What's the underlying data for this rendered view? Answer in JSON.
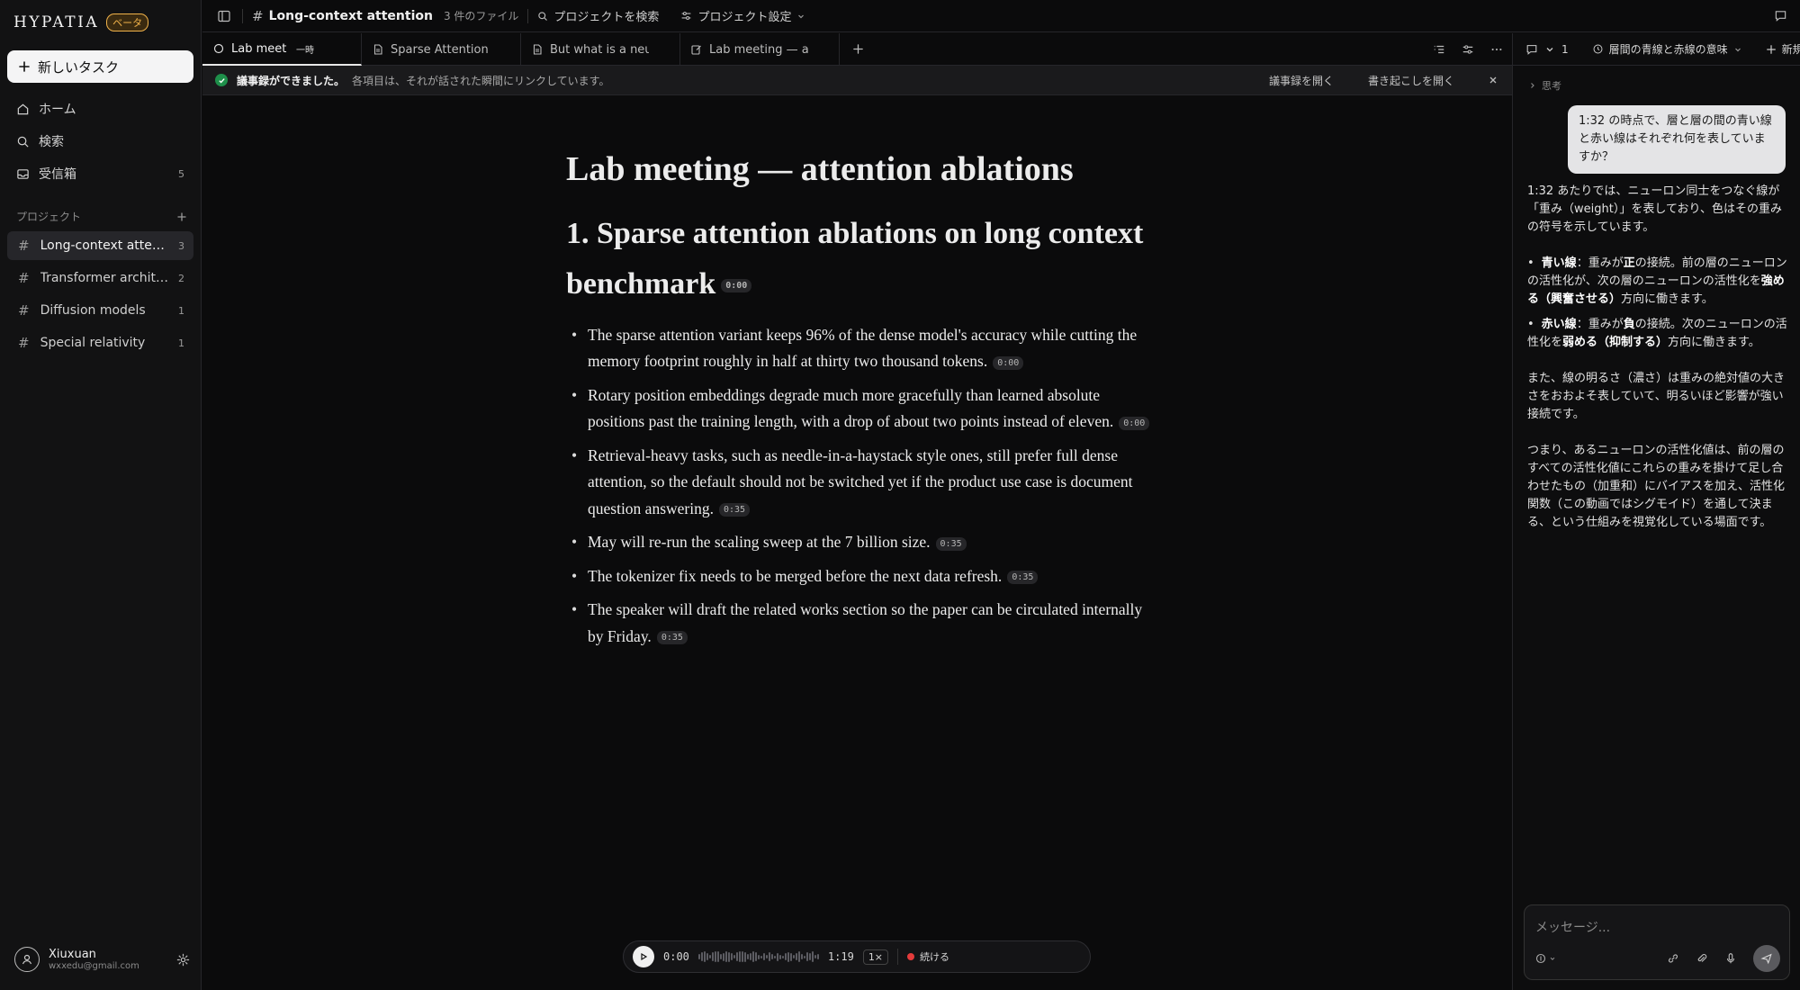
{
  "app": {
    "logo_text": "HYPATIA",
    "beta_label": "ベータ"
  },
  "sidebar": {
    "new_task_label": "新しいタスク",
    "nav": [
      {
        "label": "ホーム",
        "icon": "home-icon"
      },
      {
        "label": "検索",
        "icon": "search-icon"
      },
      {
        "label": "受信箱",
        "icon": "inbox-icon",
        "count": "5"
      }
    ],
    "projects_label": "プロジェクト",
    "projects": [
      {
        "name": "Long-context attention",
        "count": "3",
        "active": true
      },
      {
        "name": "Transformer architectures",
        "count": "2"
      },
      {
        "name": "Diffusion models",
        "count": "1"
      },
      {
        "name": "Special relativity",
        "count": "1"
      }
    ],
    "user": {
      "name": "Xiuxuan",
      "email": "wxxedu@gmail.com"
    }
  },
  "topbar": {
    "project_title": "Long-context attention",
    "file_count": "3 件のファイル",
    "search_label": "プロジェクトを検索",
    "settings_label": "プロジェクト設定"
  },
  "tabs": [
    {
      "title": "Lab meeting — attention ablations",
      "badge": "一時",
      "active": true
    },
    {
      "title": "Sparse Attention Benchmarks"
    },
    {
      "title": "But what is a neural network"
    },
    {
      "title": "Lab meeting — attention ablations"
    }
  ],
  "banner": {
    "title": "議事録ができました。",
    "subtitle": "各項目は、それが話された瞬間にリンクしています。",
    "open_minutes": "議事録を開く",
    "open_transcript": "書き起こしを開く"
  },
  "document": {
    "title": "Lab meeting — attention ablations",
    "section_title": "1. Sparse attention ablations on long context benchmark",
    "section_ts": "0:00",
    "bullets": [
      {
        "text": "The sparse attention variant keeps 96% of the dense model's accuracy while cutting the memory footprint roughly in half at thirty two thousand tokens.",
        "ts": "0:00"
      },
      {
        "text": "Rotary position embeddings degrade much more gracefully than learned absolute positions past the training length, with a drop of about two points instead of eleven.",
        "ts": "0:00"
      },
      {
        "text": "Retrieval-heavy tasks, such as needle-in-a-haystack style ones, still prefer full dense attention, so the default should not be switched yet if the product use case is document question answering.",
        "ts": "0:35"
      },
      {
        "text": "May will re-run the scaling sweep at the 7 billion size.",
        "ts": "0:35"
      },
      {
        "text": "The tokenizer fix needs to be merged before the next data refresh.",
        "ts": "0:35"
      },
      {
        "text": "The speaker will draft the related works section so the paper can be circulated internally by Friday.",
        "ts": "0:35"
      }
    ]
  },
  "player": {
    "current": "0:00",
    "duration": "1:19",
    "speed": "1×",
    "continue_label": "続ける"
  },
  "chat": {
    "conversation_count": "1",
    "conversation_title": "層間の青線と赤線の意味",
    "new_label": "新規",
    "thinking_label": "思考",
    "user_message": "1:32 の時点で、層と層の間の青い線と赤い線はそれぞれ何を表していますか？",
    "answer": {
      "intro": "1:32 あたりでは、ニューロン同士をつなぐ線が「重み（weight）」を表しており、色はその重みの符号を示しています。",
      "blue_term": "青い線",
      "blue_a": "：重みが",
      "blue_bold1": "正",
      "blue_b": "の接続。前の層のニューロンの活性化が、次の層のニューロンの活性化を",
      "blue_bold2": "強める（興奮させる）",
      "blue_c": "方向に働きます。",
      "red_term": "赤い線",
      "red_a": "：重みが",
      "red_bold1": "負",
      "red_b": "の接続。次のニューロンの活性化を",
      "red_bold2": "弱める（抑制する）",
      "red_c": "方向に働きます。",
      "para2": "また、線の明るさ（濃さ）は重みの絶対値の大きさをおおよそ表していて、明るいほど影響が強い接続です。",
      "para3": "つまり、あるニューロンの活性化値は、前の層のすべての活性化値にこれらの重みを掛けて足し合わせたもの（加重和）にバイアスを加え、活性化関数（この動画ではシグモイド）を通して決まる、という仕組みを視覚化している場面です。"
    },
    "input_placeholder": "メッセージ..."
  }
}
